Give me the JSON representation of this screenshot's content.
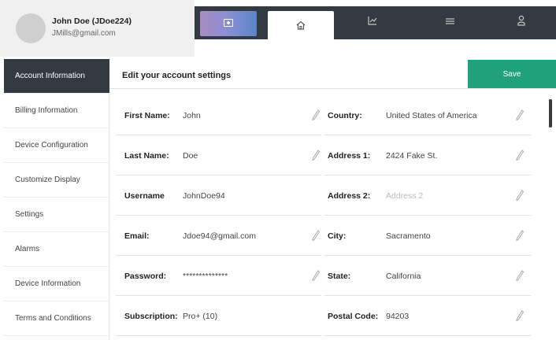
{
  "profile": {
    "name": "John Doe (JDoe224)",
    "email": "JMills@gmail.com"
  },
  "nav_tabs": [
    {
      "icon": "launch-icon"
    },
    {
      "icon": "home-icon",
      "active": true
    },
    {
      "icon": "chart-icon"
    },
    {
      "icon": "list-icon"
    },
    {
      "icon": "user-icon"
    }
  ],
  "sidebar": {
    "items": [
      {
        "label": "Account Information",
        "active": true
      },
      {
        "label": "Billing Information"
      },
      {
        "label": "Device Configuration"
      },
      {
        "label": "Customize Display"
      },
      {
        "label": "Settings"
      },
      {
        "label": "Alarms"
      },
      {
        "label": "Device Information"
      },
      {
        "label": "Terms and Conditions"
      }
    ]
  },
  "main": {
    "title": "Edit your account settings",
    "save_label": "Save",
    "left_fields": [
      {
        "label": "First Name:",
        "value": "John"
      },
      {
        "label": "Last Name:",
        "value": "Doe"
      },
      {
        "label": "Username",
        "value": "JohnDoe94"
      },
      {
        "label": "Email:",
        "value": "Jdoe94@gmail.com"
      },
      {
        "label": "Password:",
        "value": "**************"
      },
      {
        "label": "Subscription:",
        "value": "Pro+ (10)"
      }
    ],
    "right_fields": [
      {
        "label": "Country:",
        "value": "United States of America"
      },
      {
        "label": "Address 1:",
        "value": "2424 Fake St."
      },
      {
        "label": "Address 2:",
        "placeholder": "Address 2"
      },
      {
        "label": "City:",
        "value": "Sacramento"
      },
      {
        "label": "State:",
        "value": "California"
      },
      {
        "label": "Postal Code:",
        "value": "94203"
      }
    ]
  },
  "colors": {
    "nav_dark": "#333a42",
    "accent_green": "#21a17b"
  }
}
